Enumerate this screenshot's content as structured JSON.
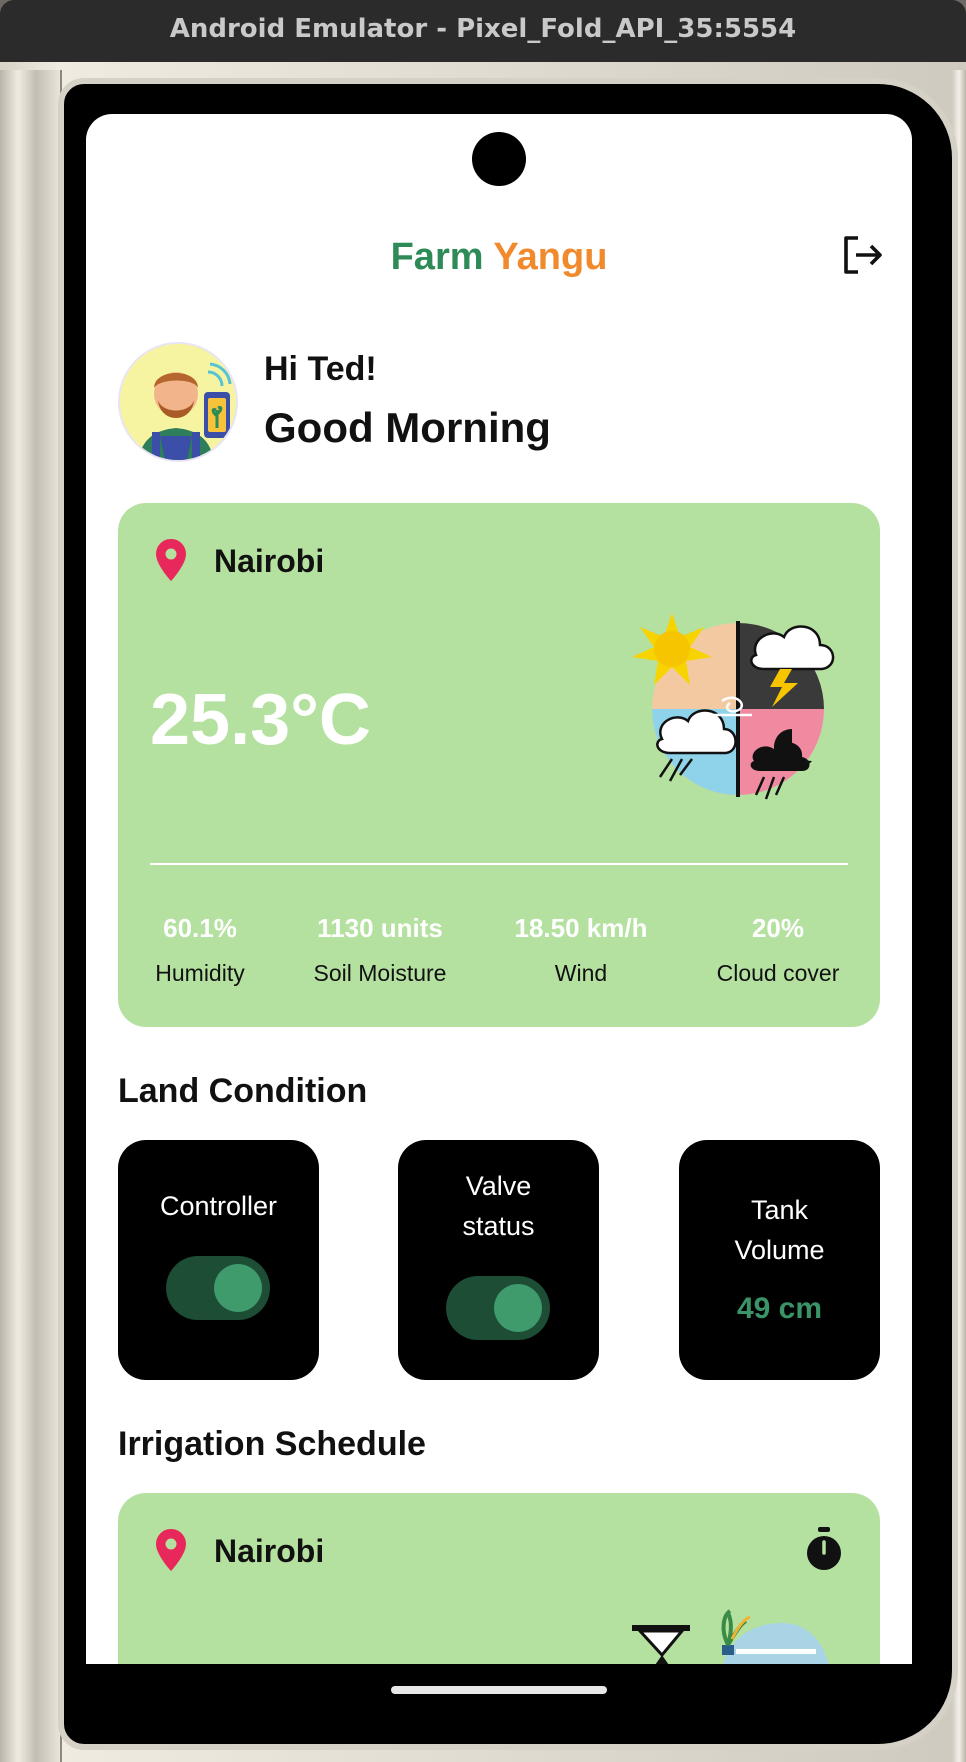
{
  "window": {
    "title": "Android Emulator - Pixel_Fold_API_35:5554"
  },
  "header": {
    "title_part1": "Farm",
    "title_part2": " Yangu",
    "title_colors": [
      "#2e8b57",
      "#f08a2c"
    ],
    "logout_icon": "logout-icon"
  },
  "greeting": {
    "hi": "Hi Ted!",
    "salutation": "Good Morning",
    "avatar_icon": "farmer-avatar"
  },
  "weather": {
    "location": "Nairobi",
    "location_icon": "location-pin-icon",
    "temperature": "25.3°C",
    "illustration": "weather-illustration",
    "card_color": "#b5e1a0",
    "stats": [
      {
        "value": "60.1%",
        "label": "Humidity"
      },
      {
        "value": "1130 units",
        "label": "Soil Moisture"
      },
      {
        "value": "18.50 km/h",
        "label": "Wind"
      },
      {
        "value": "20%",
        "label": "Cloud cover"
      }
    ]
  },
  "land_condition": {
    "title": "Land Condition",
    "controller": {
      "label": "Controller",
      "on": true
    },
    "valve": {
      "label_line1": "Valve",
      "label_line2": "status",
      "on": true
    },
    "tank": {
      "label_line1": "Tank",
      "label_line2": "Volume",
      "value": "49 cm"
    }
  },
  "irrigation": {
    "title": "Irrigation Schedule",
    "location": "Nairobi",
    "timer_icon": "stopwatch-icon"
  },
  "colors": {
    "accent_green": "#2e8b57",
    "accent_orange": "#f08a2c",
    "pin_red": "#e8285a",
    "toggle_track": "#1d4d35",
    "toggle_knob": "#3f9a6c"
  }
}
